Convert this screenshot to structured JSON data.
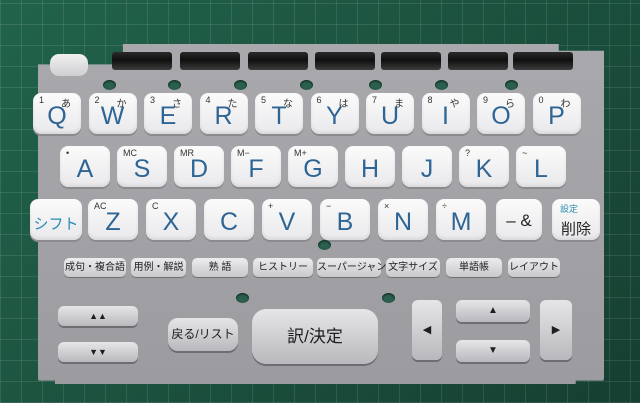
{
  "colors": {
    "legend_blue": "#2f6594",
    "accent_blue": "#2a8ab3",
    "plate": "#a9a9ad",
    "mat": "#1f5a45"
  },
  "row1": [
    {
      "main": "Q",
      "small": "1",
      "kana": "あ"
    },
    {
      "main": "W",
      "small": "2",
      "kana": "か"
    },
    {
      "main": "E",
      "small": "3",
      "kana": "さ"
    },
    {
      "main": "R",
      "small": "4",
      "kana": "た"
    },
    {
      "main": "T",
      "small": "5",
      "kana": "な"
    },
    {
      "main": "Y",
      "small": "6",
      "kana": "は"
    },
    {
      "main": "U",
      "small": "7",
      "kana": "ま"
    },
    {
      "main": "I",
      "small": "8",
      "kana": "や"
    },
    {
      "main": "O",
      "small": "9",
      "kana": "ら"
    },
    {
      "main": "P",
      "small": "0",
      "kana": "わ"
    }
  ],
  "row2": [
    {
      "main": "A",
      "small": "•"
    },
    {
      "main": "S",
      "small": "MC"
    },
    {
      "main": "D",
      "small": "MR"
    },
    {
      "main": "F",
      "small": "M−"
    },
    {
      "main": "G",
      "small": "M+"
    },
    {
      "main": "H",
      "small": ""
    },
    {
      "main": "J",
      "small": ""
    },
    {
      "main": "K",
      "small": "?"
    },
    {
      "main": "L",
      "small": "~"
    }
  ],
  "row3": {
    "shift": "シフト",
    "keys": [
      {
        "main": "Z",
        "small": "AC"
      },
      {
        "main": "X",
        "small": "C"
      },
      {
        "main": "C",
        "small": ""
      },
      {
        "main": "V",
        "small": "+"
      },
      {
        "main": "B",
        "small": "−"
      },
      {
        "main": "N",
        "small": "×"
      },
      {
        "main": "M",
        "small": "÷"
      }
    ],
    "dash_amp": "– &",
    "settings": "設定",
    "delete": "削除"
  },
  "function_keys": [
    "成句・複合語",
    "用例・解説",
    "熟 語",
    "ヒストリー",
    "スーパージャンプ",
    "文字サイズ",
    "単語帳",
    "レイアウト"
  ],
  "bottom": {
    "back_list": "戻る/リスト",
    "translate_enter": "訳/決定",
    "page_up": "▲▲",
    "page_down": "▼▼",
    "left": "◀",
    "right": "▶",
    "up": "▲",
    "down": "▼"
  }
}
